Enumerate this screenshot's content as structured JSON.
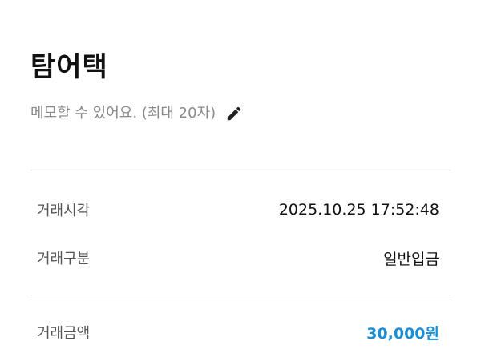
{
  "header": {
    "title": "탐어택"
  },
  "memo": {
    "placeholder_text": "메모할 수 있어요. (최대 20자)",
    "edit_icon": "pencil-icon"
  },
  "details": {
    "rows": [
      {
        "label": "거래시각",
        "value": "2025.10.25 17:52:48"
      },
      {
        "label": "거래구분",
        "value": "일반입금"
      }
    ],
    "amount": {
      "label": "거래금액",
      "value": "30,000원"
    }
  },
  "colors": {
    "amount": "#1a8ed6",
    "label": "#555555",
    "memo": "#8a8a8a",
    "divider": "#dcdcdc"
  }
}
